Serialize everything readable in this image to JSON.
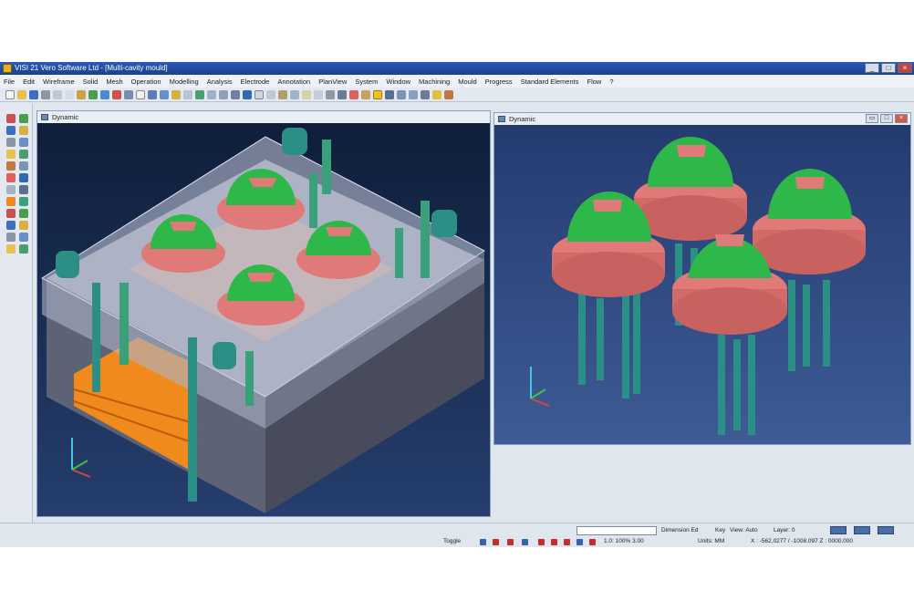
{
  "window": {
    "title": "VISI 21 Vero Software Ltd - [Multi-cavity mould]",
    "controls": [
      "_",
      "□",
      "×"
    ]
  },
  "menu": [
    "File",
    "Edit",
    "Wireframe",
    "Solid",
    "Mesh",
    "Operation",
    "Modelling",
    "Analysis",
    "Electrode",
    "Annotation",
    "PlanView",
    "System",
    "Window",
    "Machining",
    "Mould",
    "Progress",
    "Standard Elements",
    "Flow",
    "?"
  ],
  "viewports": {
    "left": {
      "title": "Dynamic"
    },
    "right": {
      "title": "Dynamic",
      "controls": [
        "▭",
        "□",
        "×"
      ]
    }
  },
  "status": {
    "dimension_label": "Dimension Ed",
    "pick_label": "Key",
    "view_label": "View: Auto",
    "layer_label": "Layer: 0",
    "toggle_label": "Toggle",
    "scale_readout": "1.0: 100% 3.00",
    "units_label": "Units: MM",
    "coordinates": "X : -562.0277 / -1008.097 Z : 0000.000"
  },
  "colors": {
    "title_bar": "#1f4a9e",
    "viewport_left_bg": "#1b2d52",
    "viewport_right_bg": "#304a82",
    "dome_green": "#2fb84a",
    "cavity_pink": "#e07a78",
    "plate_orange": "#f08a1c",
    "pin_teal": "#2c8f86"
  }
}
